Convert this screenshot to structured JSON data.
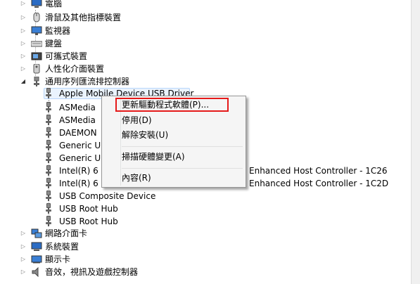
{
  "tree": {
    "categories_top": [
      {
        "label": "電腦",
        "icon": "computer-icon"
      },
      {
        "label": "滑鼠及其他指標裝置",
        "icon": "mouse-icon"
      },
      {
        "label": "監視器",
        "icon": "monitor-icon"
      },
      {
        "label": "鍵盤",
        "icon": "keyboard-icon"
      },
      {
        "label": "可攜式裝置",
        "icon": "portable-device-icon"
      },
      {
        "label": "人性化介面裝置",
        "icon": "hid-icon"
      }
    ],
    "expanded_category": {
      "label": "通用序列匯流排控制器",
      "icon": "usb-controller-icon"
    },
    "usb_devices": [
      "Apple Mobile Device USB Driver",
      "ASMedia",
      "ASMedia",
      "DAEMON",
      "Generic U",
      "Generic U",
      "Intel(R) 6",
      "Intel(R) 6",
      "USB Composite Device",
      "USB Root Hub",
      "USB Root Hub"
    ],
    "usb_device_tails": {
      "6": "Enhanced Host Controller - 1C26",
      "7": "Enhanced Host Controller - 1C2D"
    },
    "categories_bottom": [
      {
        "label": "網路介面卡",
        "icon": "network-adapter-icon"
      },
      {
        "label": "系統裝置",
        "icon": "system-device-icon"
      },
      {
        "label": "顯示卡",
        "icon": "display-adapter-icon"
      },
      {
        "label": "音效，視訊及遊戲控制器",
        "icon": "speaker-icon"
      }
    ]
  },
  "context_menu": {
    "items": [
      {
        "label": "更新驅動程式軟體(P)...",
        "highlighted": true
      },
      {
        "label": "停用(D)"
      },
      {
        "label": "解除安裝(U)"
      },
      {
        "label": "掃描硬體變更(A)"
      },
      {
        "label": "內容(R)"
      }
    ],
    "highlight_color": "#e51a1a"
  },
  "colors": {
    "selection_border": "#b8d6fb",
    "selection_fill": "#eaf3fd",
    "menu_background": "#f5f5f5"
  }
}
